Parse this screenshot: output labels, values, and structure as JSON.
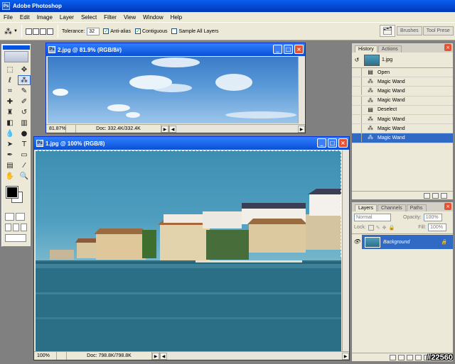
{
  "app": {
    "title": "Adobe Photoshop"
  },
  "menu": [
    "File",
    "Edit",
    "Image",
    "Layer",
    "Select",
    "Filter",
    "View",
    "Window",
    "Help"
  ],
  "options": {
    "tolerance_label": "Tolerance:",
    "tolerance_value": "32",
    "anti_alias": "Anti-alias",
    "contiguous": "Contiguous",
    "sample_all": "Sample All Layers",
    "well_tabs": [
      "Brushes",
      "Tool Prese"
    ]
  },
  "doc2": {
    "title": "2.jpg @ 81.9% (RGB/8#)",
    "zoom": "81.87%",
    "docsize": "Doc: 332.4K/332.4K"
  },
  "doc1": {
    "title": "1.jpg @ 100% (RGB/8)",
    "zoom": "100%",
    "docsize": "Doc: 798.8K/798.8K"
  },
  "history": {
    "tabs": [
      "History",
      "Actions"
    ],
    "snapshot": "1.jpg",
    "items": [
      "Open",
      "Magic Wand",
      "Magic Wand",
      "Magic Wand",
      "Deselect",
      "Magic Wand",
      "Magic Wand",
      "Magic Wand"
    ],
    "selected_index": 7
  },
  "layers": {
    "tabs": [
      "Layers",
      "Channels",
      "Paths"
    ],
    "blend_mode": "Normal",
    "opacity_label": "Opacity:",
    "opacity": "100%",
    "lock_label": "Lock:",
    "fill_label": "Fill:",
    "fill": "100%",
    "layer_name": "Background"
  },
  "watermark": "#22560"
}
